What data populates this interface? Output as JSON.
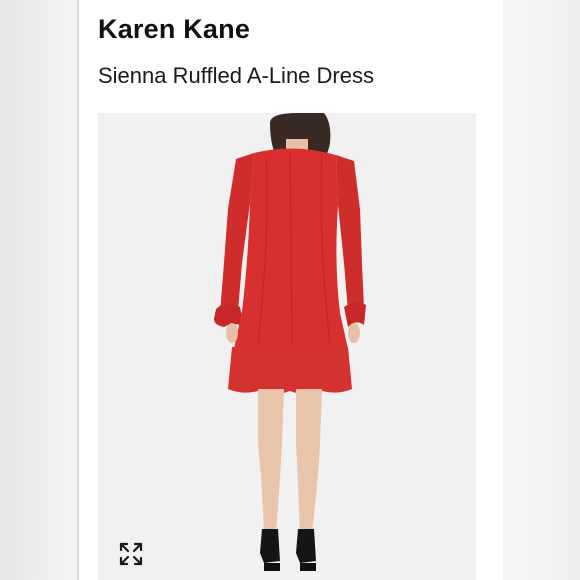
{
  "product": {
    "brand": "Karen Kane",
    "title": "Sienna Ruffled A-Line Dress"
  },
  "photo": {
    "alt": "Sienna Ruffled A-Line Dress",
    "dress_color": "#d8302f",
    "background_color": "#f1f1f1"
  },
  "controls": {
    "expand_icon": "expand-arrows-icon"
  }
}
